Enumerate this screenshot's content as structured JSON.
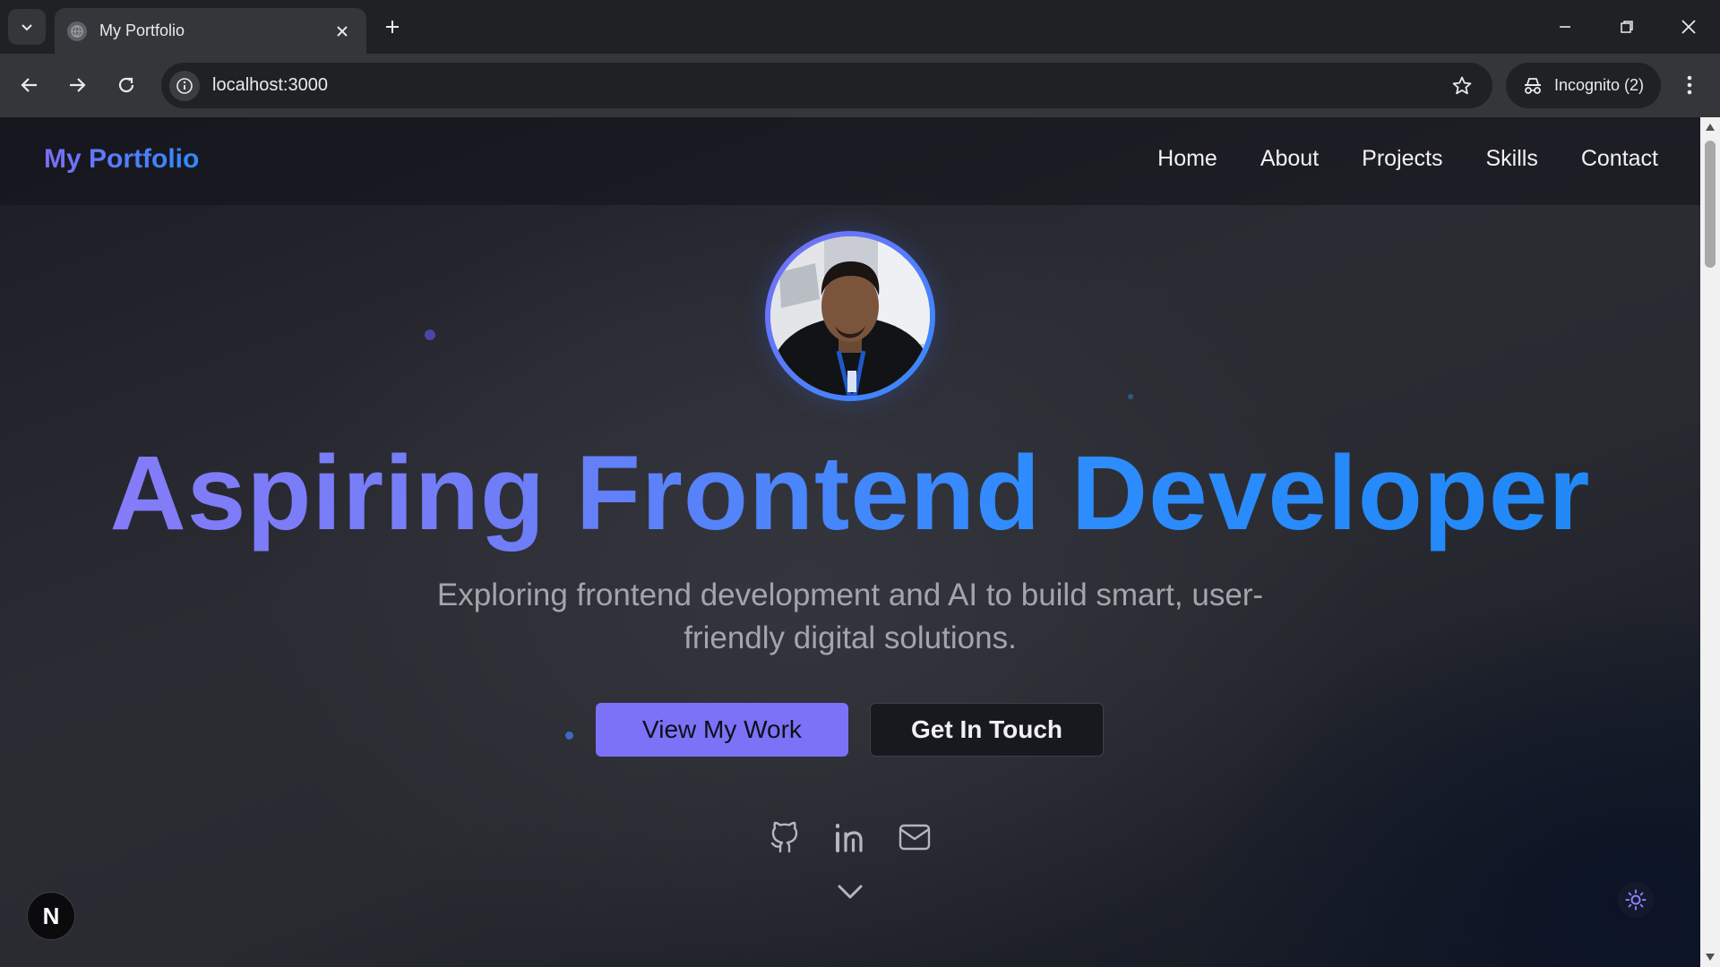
{
  "browser": {
    "tab_title": "My Portfolio",
    "url": "localhost:3000",
    "incognito_label": "Incognito (2)",
    "icons": {
      "tab_menu": "chevron-down-icon",
      "tab_close": "close-icon",
      "new_tab": "plus-icon",
      "back": "arrow-left-icon",
      "forward": "arrow-right-icon",
      "reload": "reload-icon",
      "site_info": "info-icon",
      "bookmark": "star-icon",
      "incognito": "incognito-icon",
      "menu": "kebab-icon",
      "minimize": "minimize-icon",
      "restore": "restore-icon",
      "close_window": "close-icon"
    }
  },
  "site": {
    "brand": "My Portfolio",
    "nav": [
      "Home",
      "About",
      "Projects",
      "Skills",
      "Contact"
    ],
    "hero": {
      "title": "Aspiring Frontend Developer",
      "subtitle": "Exploring frontend development and AI to build smart, user-friendly digital solutions.",
      "primary_cta": "View My Work",
      "secondary_cta": "Get In Touch"
    },
    "social_icons": [
      "github-icon",
      "linkedin-icon",
      "mail-icon"
    ],
    "badge_letter": "N",
    "colors": {
      "accent_purple": "#7b72f7",
      "accent_blue": "#2f8bff",
      "background": "#2a2b31"
    }
  }
}
